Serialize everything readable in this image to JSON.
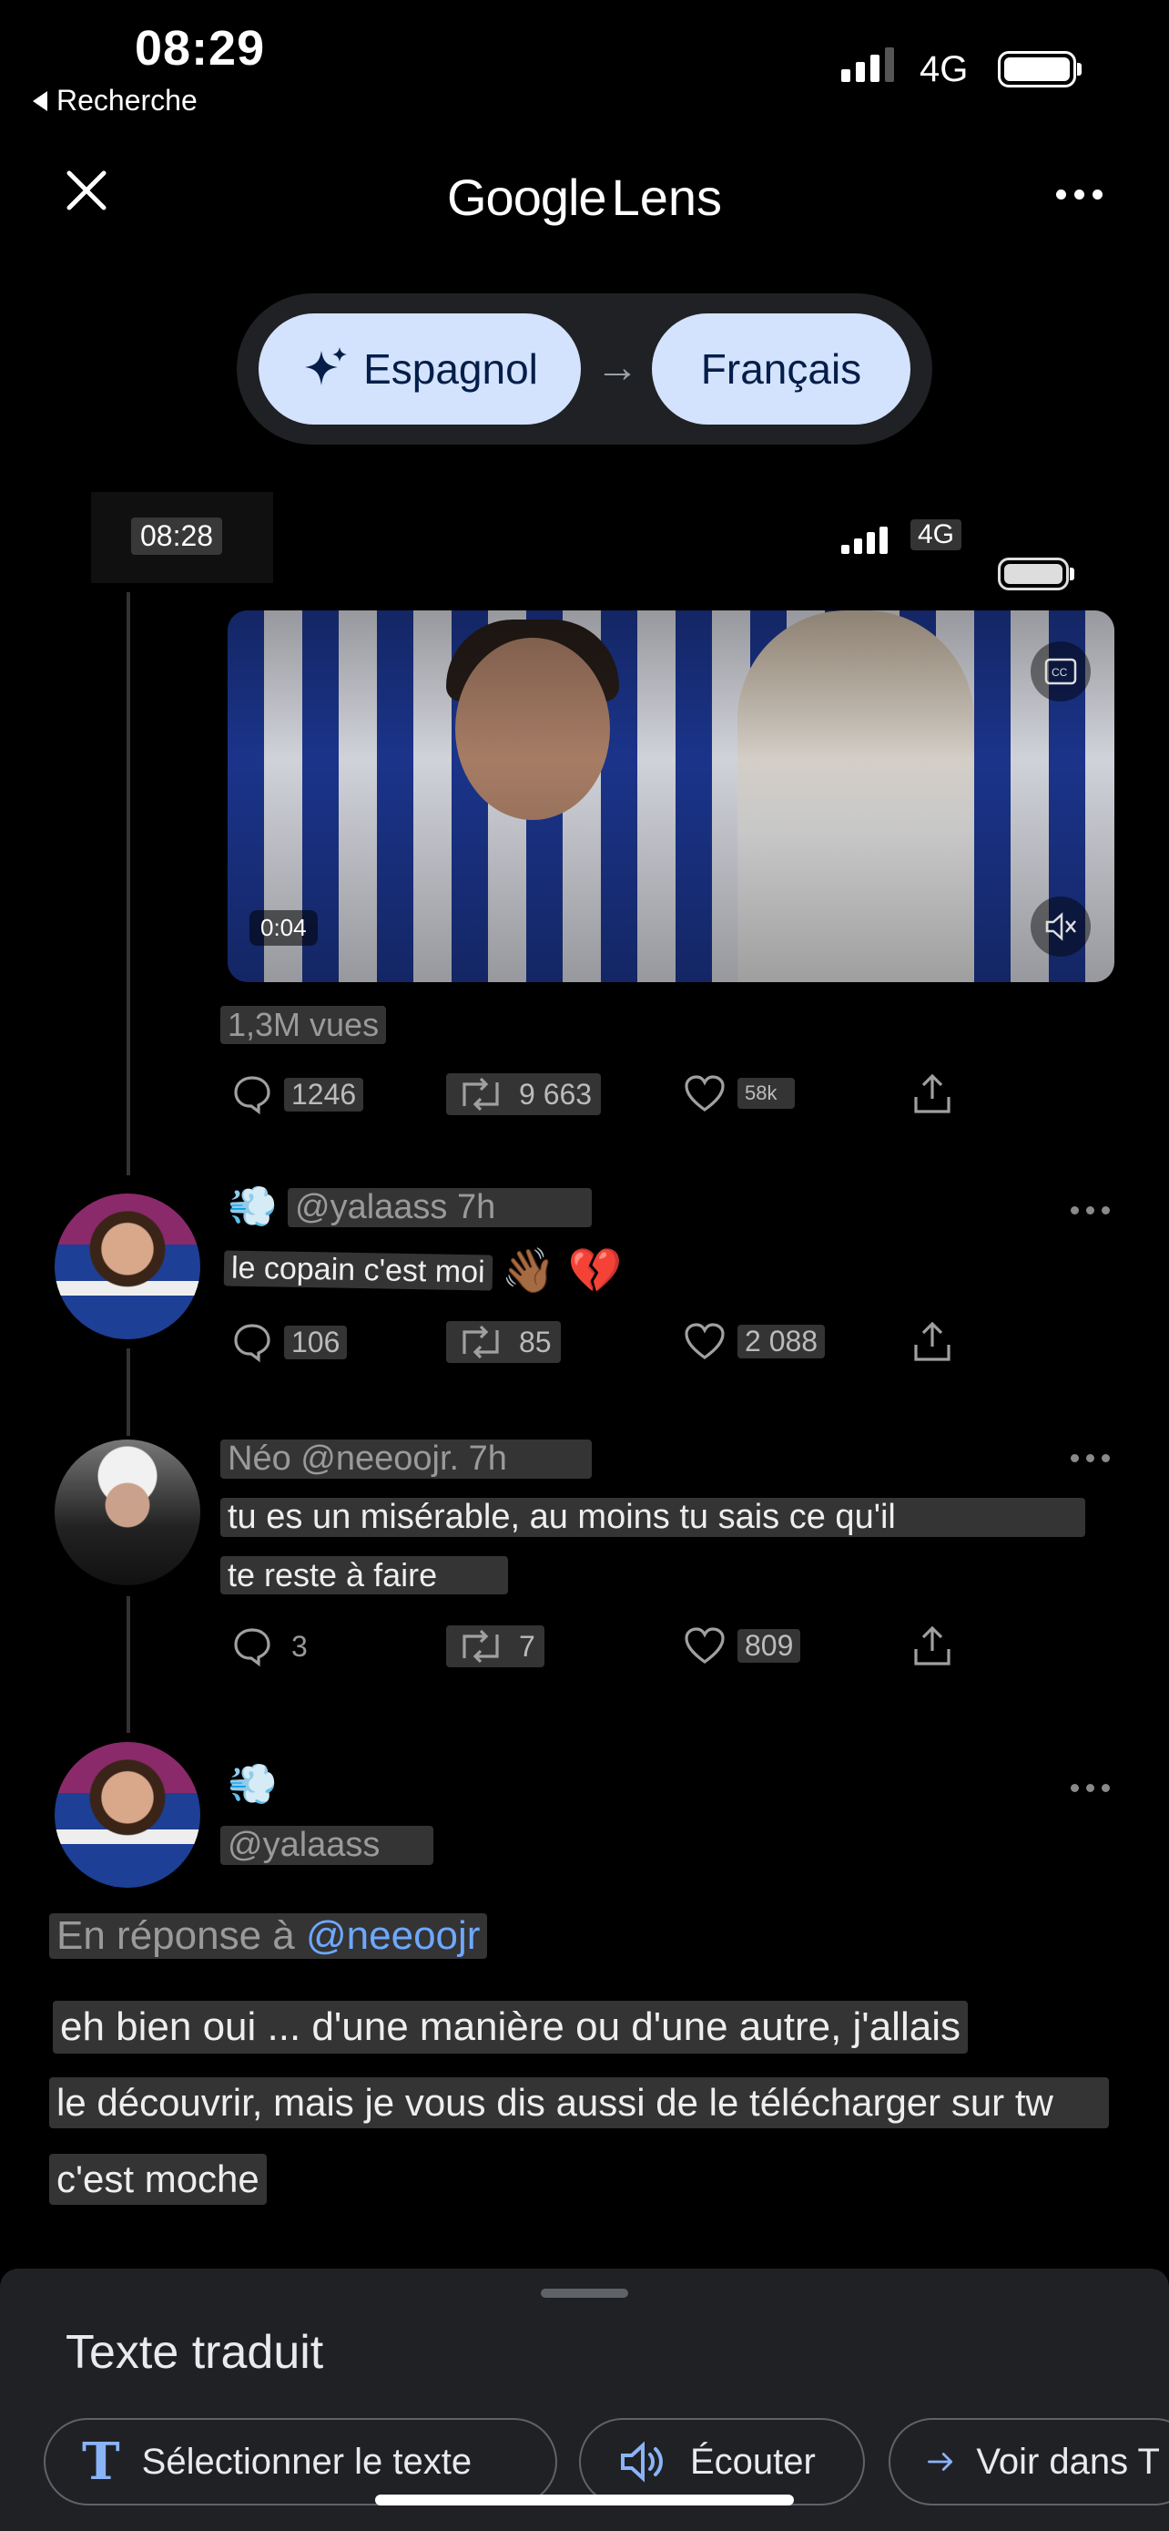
{
  "status_bar": {
    "time": "08:29",
    "back_label": "Recherche",
    "network": "4G"
  },
  "header": {
    "title_google": "Google",
    "title_lens": "Lens"
  },
  "translate": {
    "source_lang": "Espagnol",
    "target_lang": "Français"
  },
  "inner_status": {
    "time": "08:28",
    "network": "4G"
  },
  "tweet_main": {
    "video_duration": "0:04",
    "views": "1,3M vues",
    "replies": "1246",
    "retweets": "9 663",
    "likes": "58k"
  },
  "reply1": {
    "handle": "@yalaass 7h",
    "text": "le copain c'est moi",
    "emojis": "👋🏾 💔",
    "replies": "106",
    "retweets": "85",
    "likes": "2 088"
  },
  "reply2": {
    "handle": "Néo @neeoojr. 7h",
    "text_line1": "tu es un misérable, au moins tu sais ce qu'il",
    "text_line2": "te reste à faire",
    "replies": "3",
    "retweets": "7",
    "likes": "809"
  },
  "reply3": {
    "handle": "@yalaass",
    "reply_to_prefix": "En réponse à",
    "reply_to_user": "@neeoojr",
    "line1": "eh bien oui ... d'une manière ou d'une autre, j'allais",
    "line2": "le découvrir, mais je vous dis aussi de le télécharger sur tw",
    "line3": "c'est moche"
  },
  "sheet": {
    "title": "Texte traduit",
    "select_text": "Sélectionner le texte",
    "listen": "Écouter",
    "view_in": "Voir dans T"
  },
  "colors": {
    "accent_pill": "#d3e3fd",
    "link": "#6ea8ff",
    "sheet_bg": "#202124"
  }
}
